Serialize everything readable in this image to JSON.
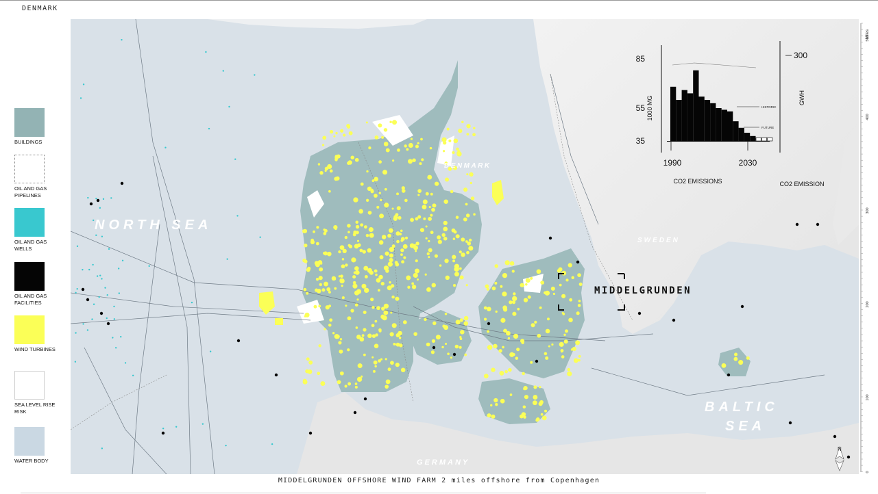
{
  "header": {
    "country": "DENMARK"
  },
  "legend": [
    {
      "label": "BUILDINGS",
      "fill": "#93b3b4",
      "border": "#93b3b4",
      "dotted": false
    },
    {
      "label": "OIL AND GAS PIPELINES",
      "fill": "#ffffff",
      "border": "#8a8a8a",
      "dotted": true
    },
    {
      "label": "OIL AND GAS WELLS",
      "fill": "#39c8cf",
      "border": "#39c8cf",
      "dotted": false
    },
    {
      "label": "OIL AND GAS FACILITIES",
      "fill": "#050505",
      "border": "#050505",
      "dotted": false
    },
    {
      "label": "WIND TURBINES",
      "fill": "#fbff57",
      "border": "#fbff57",
      "dotted": false
    },
    {
      "label": "SEA LEVEL RISE RISK",
      "fill": "#ffffff",
      "border": "#cfcfcf",
      "dotted": false
    },
    {
      "label": "WATER BODY",
      "fill": "#cad8e3",
      "border": "#cad8e3",
      "dotted": false
    }
  ],
  "map": {
    "labels": {
      "north_sea": "NORTH SEA",
      "denmark": "DENMARK",
      "sweden": "SWEDEN",
      "baltic_1": "BALTIC",
      "baltic_2": "SEA",
      "germany": "GERMANY",
      "callout": "MIDDELGRUNDEN"
    },
    "scale": {
      "unit": "Miles",
      "ticks": [
        "500",
        "400",
        "300",
        "200",
        "100",
        "0"
      ]
    },
    "compass": "N"
  },
  "chart_data": {
    "type": "bar",
    "left_axis": {
      "label": "1000 MG",
      "ticks": [
        85,
        55,
        35
      ]
    },
    "right_axis": {
      "label": "GWH",
      "ticks": [
        300
      ]
    },
    "x_ticks": [
      "1990",
      "2030"
    ],
    "bottom_labels": [
      "CO2 EMISSIONS",
      "CO2 EMISSIONS"
    ],
    "annotations": [
      "HISTORIC",
      "FUTURE"
    ],
    "historic_values": [
      68,
      60,
      66,
      64,
      78,
      62,
      60,
      58,
      55,
      54,
      53,
      47,
      43,
      40,
      38
    ],
    "future_values": [
      37,
      37,
      37
    ]
  },
  "caption": "MIDDELGRUNDEN OFFSHORE WIND FARM 2 miles offshore from Copenhagen"
}
